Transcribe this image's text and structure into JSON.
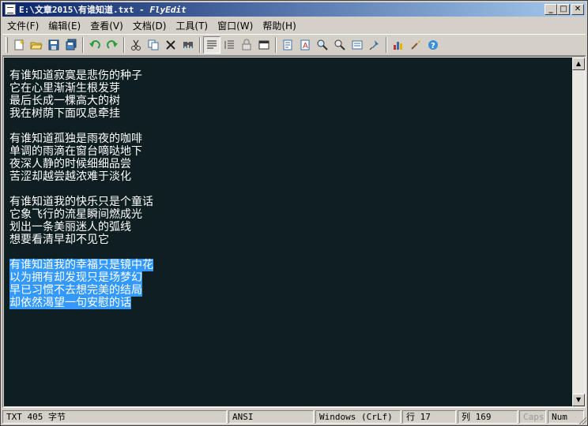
{
  "window": {
    "title": "E:\\文章2015\\有谁知道.txt",
    "title_suffix": " - FlyEdit",
    "minimize": "_",
    "maximize": "□",
    "close": "✕"
  },
  "menu": [
    {
      "label": "文件(F)"
    },
    {
      "label": "编辑(E)"
    },
    {
      "label": "查看(V)"
    },
    {
      "label": "文档(D)"
    },
    {
      "label": "工具(T)"
    },
    {
      "label": "窗口(W)"
    },
    {
      "label": "帮助(H)"
    }
  ],
  "toolbar": {
    "icons": [
      "new-file-icon",
      "open-folder-icon",
      "save-icon",
      "save-all-icon",
      "undo-icon",
      "redo-icon",
      "cut-icon",
      "copy-icon",
      "delete-icon",
      "find-icon",
      "word-wrap-icon",
      "line-numbers-icon",
      "lock-icon",
      "fullscreen-icon",
      "document-properties-icon",
      "font-icon",
      "zoom-in-icon",
      "zoom-out-icon",
      "code-page-icon",
      "pin-icon",
      "statistics-icon",
      "settings-icon",
      "help-icon"
    ]
  },
  "editor": {
    "background": "#0f1e21",
    "text_color": "#ffffff",
    "selection_color": "#3399ff",
    "stanzas": [
      [
        "有谁知道寂寞是悲伤的种子",
        "它在心里渐渐生根发芽",
        "最后长成一棵高大的树",
        "我在树荫下面叹息牵挂"
      ],
      [
        "有谁知道孤独是雨夜的咖啡",
        "单调的雨滴在窗台嘀哒地下",
        "夜深人静的时候细细品尝",
        "苦涩却越尝越浓难于淡化"
      ],
      [
        "有谁知道我的快乐只是个童话",
        "它象飞行的流星瞬间燃成光",
        "划出一条美丽迷人的弧线",
        "想要看清早却不见它"
      ],
      [
        "有谁知道我的幸福只是镜中花",
        "以为拥有却发现只是场梦幻",
        "早已习惯不去想完美的结局",
        "却依然渴望一句安慰的话"
      ]
    ],
    "selected_stanza": 3
  },
  "status": {
    "file_info": "TXT   405 字节",
    "encoding": "ANSI",
    "line_ending": "Windows (CrLf)",
    "line": "行 17",
    "column": "列 169",
    "caps": "Caps",
    "num": "Num"
  }
}
